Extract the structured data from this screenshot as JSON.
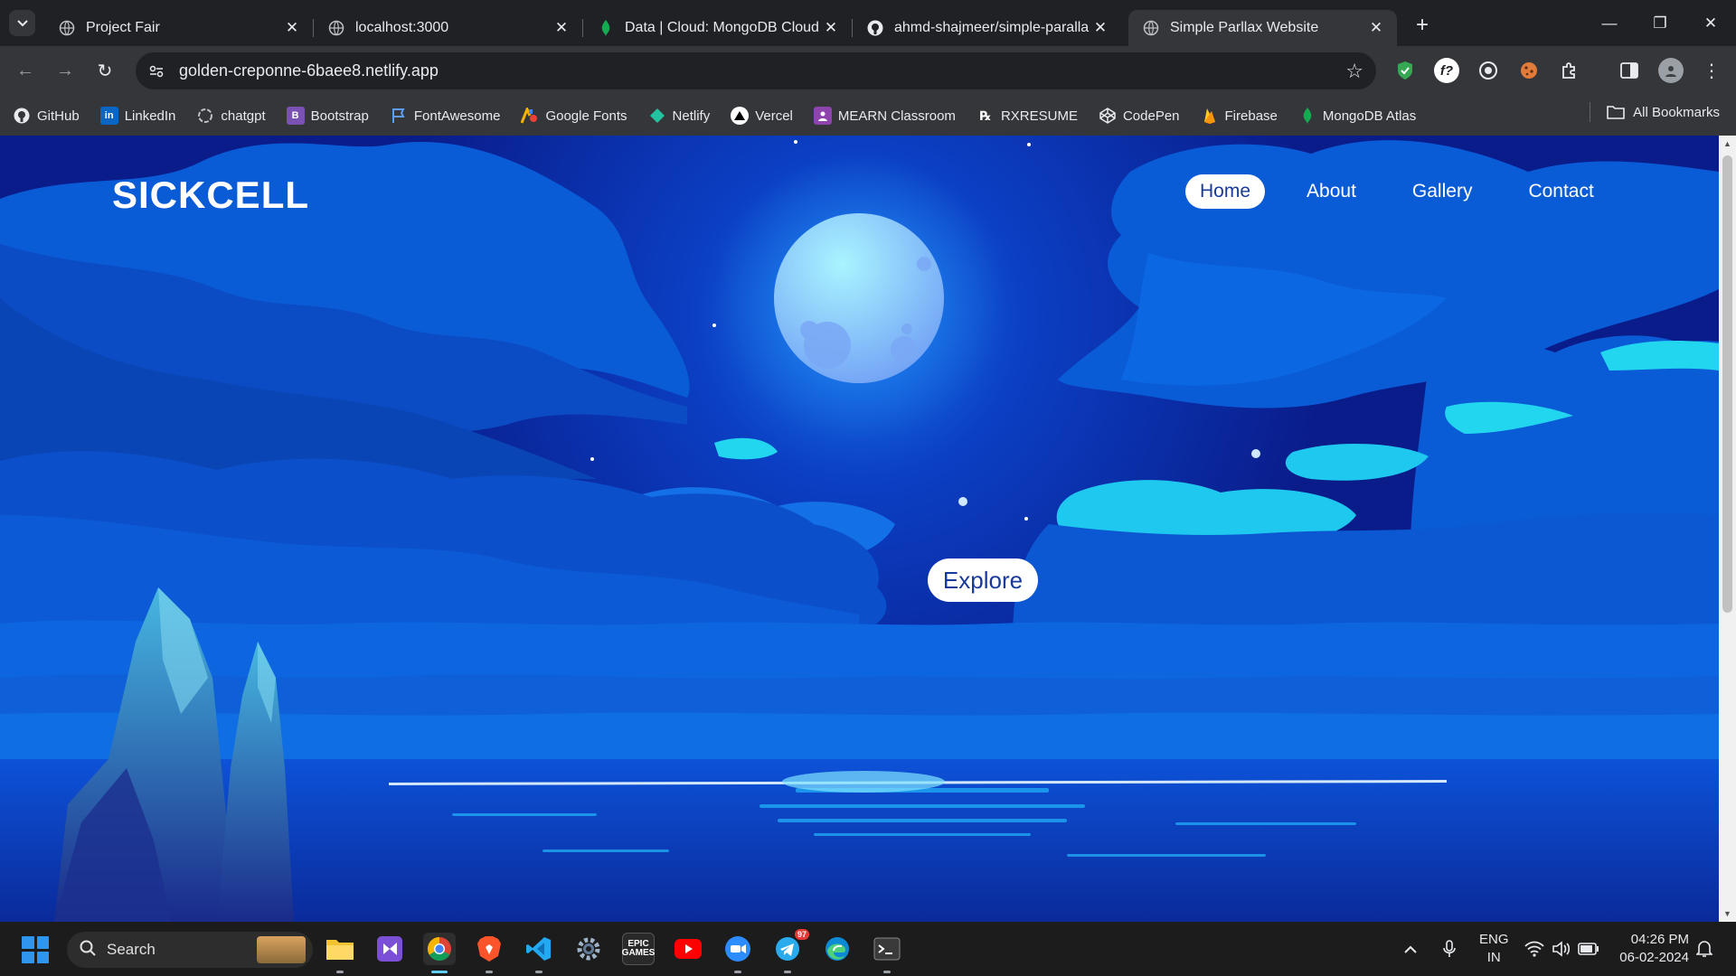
{
  "browser": {
    "tabs": [
      {
        "title": "Project Fair",
        "icon": "globe-icon",
        "active": false
      },
      {
        "title": "localhost:3000",
        "icon": "globe-icon",
        "active": false
      },
      {
        "title": "Data | Cloud: MongoDB Cloud",
        "icon": "mongodb-leaf-icon",
        "active": false
      },
      {
        "title": "ahmd-shajmeer/simple-paralla",
        "icon": "github-icon",
        "active": false
      },
      {
        "title": "Simple Parllax Website",
        "icon": "globe-icon",
        "active": true
      }
    ],
    "url": "golden-creponne-6baee8.netlify.app",
    "bookmarks": [
      {
        "label": "GitHub",
        "icon": "github-icon",
        "color": "#ffffff"
      },
      {
        "label": "LinkedIn",
        "icon": "linkedin-icon",
        "color": "#0a66c2"
      },
      {
        "label": "chatgpt",
        "icon": "chatgpt-icon",
        "color": "#9aa0a6"
      },
      {
        "label": "Bootstrap",
        "icon": "bootstrap-icon",
        "color": "#7952b3"
      },
      {
        "label": "FontAwesome",
        "icon": "flag-icon",
        "color": "#5c9ded"
      },
      {
        "label": "Google Fonts",
        "icon": "google-fonts-icon",
        "color": "#f4b400"
      },
      {
        "label": "Netlify",
        "icon": "netlify-icon",
        "color": "#25c2a0"
      },
      {
        "label": "Vercel",
        "icon": "vercel-icon",
        "color": "#ffffff"
      },
      {
        "label": "MEARN Classroom",
        "icon": "classroom-icon",
        "color": "#8e44ad"
      },
      {
        "label": "RXRESUME",
        "icon": "rx-icon",
        "color": "#ffffff"
      },
      {
        "label": "CodePen",
        "icon": "codepen-icon",
        "color": "#ffffff"
      },
      {
        "label": "Firebase",
        "icon": "firebase-icon",
        "color": "#ffca28"
      },
      {
        "label": "MongoDB Atlas",
        "icon": "mongodb-leaf-icon",
        "color": "#13aa52"
      }
    ],
    "all_bookmarks": "All Bookmarks"
  },
  "site": {
    "logo": "SICKCELL",
    "nav": [
      "Home",
      "About",
      "Gallery",
      "Contact"
    ],
    "active_nav": "Home",
    "cta": "Explore"
  },
  "taskbar": {
    "search_label": "Search",
    "telegram_badge": "97",
    "lang_top": "ENG",
    "lang_bottom": "IN",
    "time": "04:26 PM",
    "date": "06-02-2024",
    "apps": [
      {
        "name": "file-explorer-icon",
        "color": "#f2c233"
      },
      {
        "name": "visual-studio-icon",
        "color": "#7b4fd6"
      },
      {
        "name": "chrome-icon",
        "color": "#34a853"
      },
      {
        "name": "brave-icon",
        "color": "#fb542b"
      },
      {
        "name": "vscode-icon",
        "color": "#23a9f2"
      },
      {
        "name": "settings-icon",
        "color": "#6e7b8a"
      },
      {
        "name": "epic-games-icon",
        "color": "#2a2a2a"
      },
      {
        "name": "youtube-icon",
        "color": "#ff0000"
      },
      {
        "name": "zoom-icon",
        "color": "#2d8cff"
      },
      {
        "name": "telegram-icon",
        "color": "#2aabee"
      },
      {
        "name": "edge-icon",
        "color": "#0c8ad6"
      },
      {
        "name": "terminal-icon",
        "color": "#3a3a3a"
      }
    ]
  }
}
